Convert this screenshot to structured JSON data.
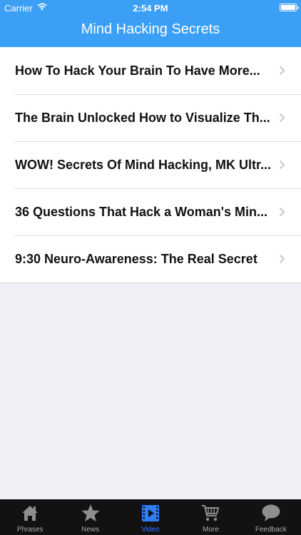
{
  "status_bar": {
    "carrier": "Carrier",
    "time": "2:54 PM"
  },
  "header": {
    "title": "Mind Hacking Secrets"
  },
  "list": [
    {
      "label": "How To Hack Your Brain To Have More..."
    },
    {
      "label": "The Brain Unlocked How to Visualize Th..."
    },
    {
      "label": "WOW! Secrets Of Mind Hacking, MK Ultr..."
    },
    {
      "label": "36 Questions That Hack a Woman's Min..."
    },
    {
      "label": "9:30 Neuro-Awareness: The Real Secret"
    }
  ],
  "tabbar": {
    "active": "Video",
    "items": [
      {
        "label": "Phrases",
        "icon": "home-icon"
      },
      {
        "label": "News",
        "icon": "star-icon"
      },
      {
        "label": "Video",
        "icon": "film-icon"
      },
      {
        "label": "More",
        "icon": "cart-icon"
      },
      {
        "label": "Feedback",
        "icon": "speech-bubble-icon"
      }
    ]
  },
  "colors": {
    "accent": "#3a9ff5",
    "tab_active": "#2e7ff7",
    "tab_inactive": "#a9a9a9",
    "tabbar_bg": "#121212"
  }
}
